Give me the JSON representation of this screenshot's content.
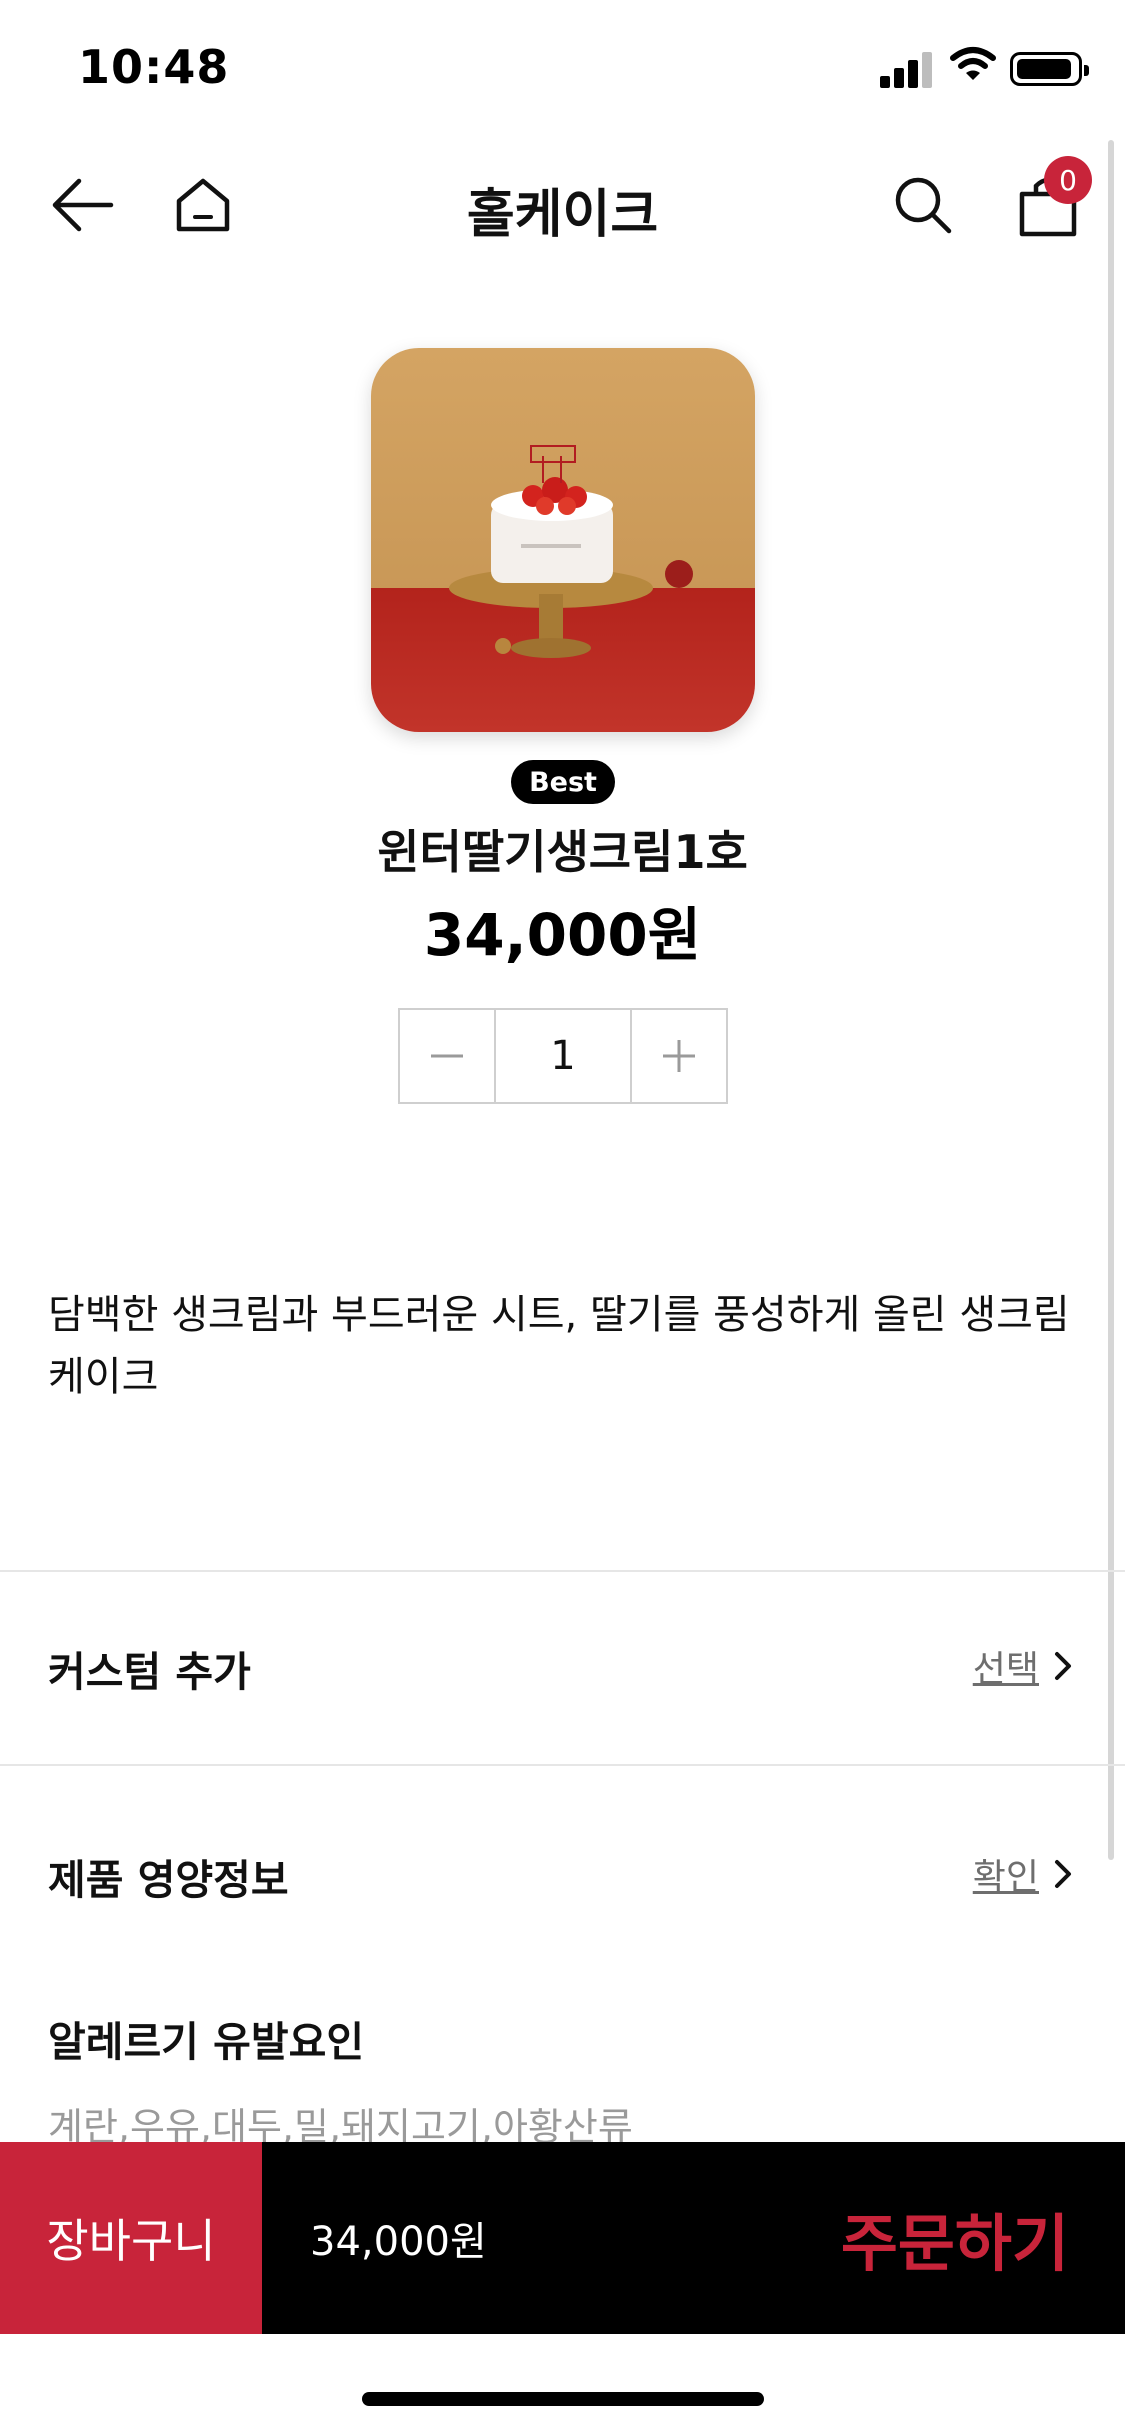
{
  "status_bar": {
    "time": "10:48"
  },
  "header": {
    "title": "홀케이크",
    "cart_count": "0"
  },
  "product": {
    "badge": "Best",
    "name": "윈터딸기생크림1호",
    "price": "34,000원",
    "quantity": "1",
    "description": "담백한 생크림과 부드러운 시트, 딸기를 풍성하게 올린 생크림 케이크",
    "image_icon": "cake-photo"
  },
  "options": {
    "custom": {
      "label": "커스텀 추가",
      "action": "선택"
    },
    "nutrition": {
      "label": "제품 영양정보",
      "action": "확인"
    },
    "allergen": {
      "label": "알레르기 유발요인",
      "value": "계란,우유,대두,밀,돼지고기,아황산류"
    }
  },
  "bottom_bar": {
    "cart_label": "장바구니",
    "total": "34,000원",
    "order_label": "주문하기"
  },
  "colors": {
    "accent": "#c8243a",
    "bar": "#000000"
  }
}
